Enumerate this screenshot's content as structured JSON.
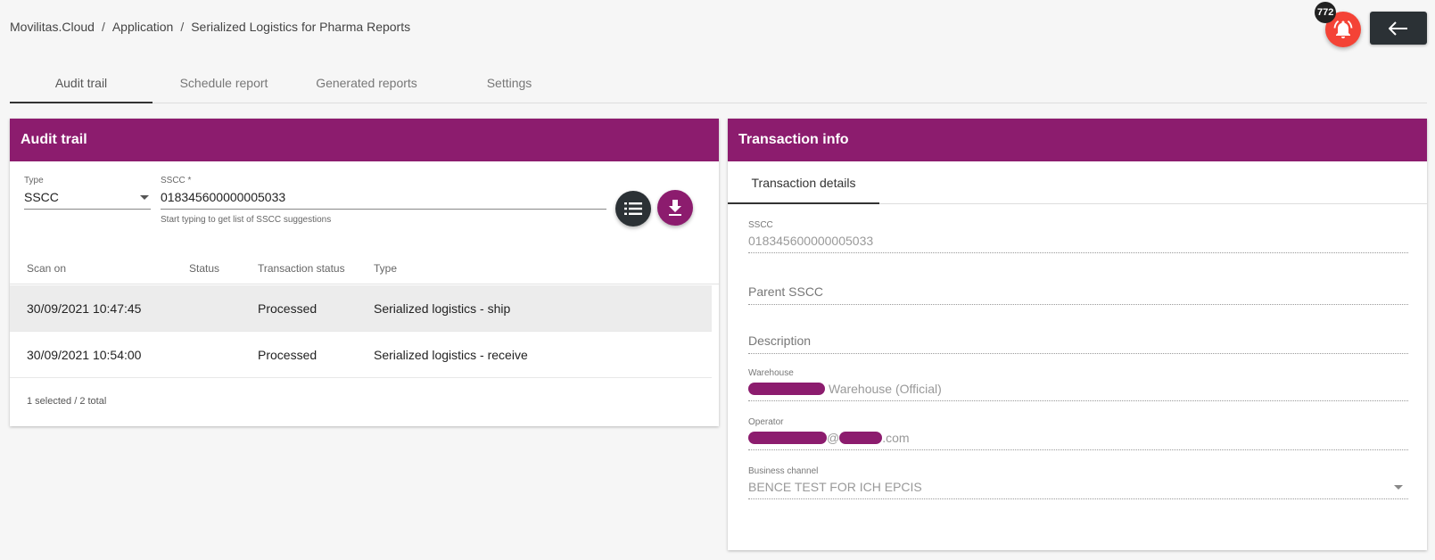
{
  "breadcrumb": {
    "root": "Movilitas.Cloud",
    "app": "Application",
    "page": "Serialized Logistics for Pharma Reports"
  },
  "notifications": {
    "count": "772"
  },
  "main_tabs": [
    {
      "label": "Audit trail"
    },
    {
      "label": "Schedule report"
    },
    {
      "label": "Generated reports"
    },
    {
      "label": "Settings"
    }
  ],
  "audit": {
    "title": "Audit trail",
    "type_label": "Type",
    "type_value": "SSCC",
    "sscc_label": "SSCC *",
    "sscc_value": "018345600000005033",
    "sscc_hint": "Start typing to get list of SSCC suggestions",
    "columns": [
      "Scan on",
      "Status",
      "Transaction status",
      "Type"
    ],
    "rows": [
      {
        "scan_on": "30/09/2021 10:47:45",
        "status": "",
        "transaction_status": "Processed",
        "type": "Serialized logistics - ship"
      },
      {
        "scan_on": "30/09/2021 10:54:00",
        "status": "",
        "transaction_status": "Processed",
        "type": "Serialized logistics - receive"
      }
    ],
    "footer": "1 selected / 2 total"
  },
  "transaction": {
    "title": "Transaction info",
    "tab": "Transaction details",
    "sscc_label": "SSCC",
    "sscc_value": "018345600000005033",
    "parent_sscc_label": "Parent SSCC",
    "description_label": "Description",
    "warehouse_label": "Warehouse",
    "warehouse_value": "Warehouse (Official)",
    "operator_label": "Operator",
    "operator_at": "@",
    "operator_domain": ".com",
    "business_channel_label": "Business channel",
    "business_channel_value": "BENCE TEST FOR ICH EPCIS"
  },
  "colors": {
    "primary": "#8c1c6e",
    "dark": "#2b3135",
    "alert": "#f44336"
  }
}
